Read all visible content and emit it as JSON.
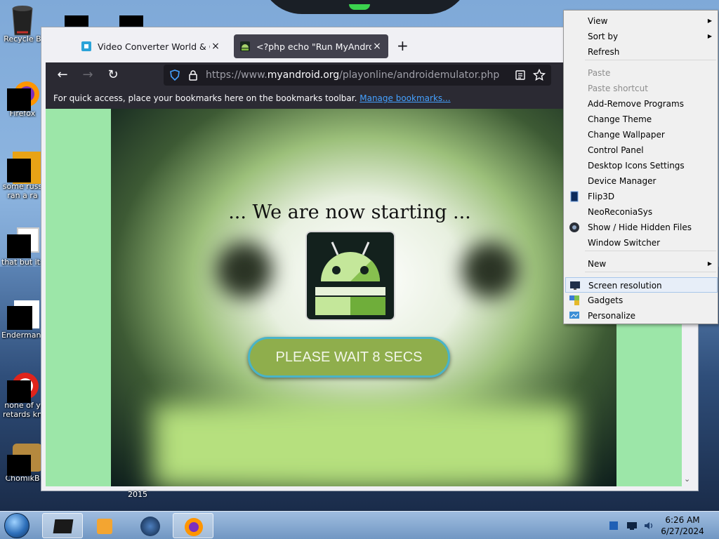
{
  "desktop": {
    "icons": [
      {
        "label": "Recycle B"
      },
      {
        "label": "Firefox"
      },
      {
        "label": "some russ",
        "label2": "ran a ra"
      },
      {
        "label": "that but its"
      },
      {
        "label": "Endermann"
      },
      {
        "label": "none of y",
        "label2": "retards kn"
      },
      {
        "label": "ChomikB"
      }
    ],
    "year_text": "2015"
  },
  "browser": {
    "tabs": [
      {
        "title": "Video Converter World & Custo",
        "close": "×"
      },
      {
        "title": "<?php echo \"Run MyAndroid\"; ?>",
        "close": "×"
      }
    ],
    "new_tab": "+",
    "url": {
      "prefix": "https://www.",
      "domain": "myandroid.org",
      "path": "/playonline/androidemulator.php"
    },
    "bookmarks_bar": {
      "text": "For quick access, place your bookmarks here on the bookmarks toolbar.",
      "link": "Manage bookmarks..."
    }
  },
  "page": {
    "headline": "... We are now starting ...",
    "button": "PLEASE WAIT 8 SECS"
  },
  "context_menu": {
    "items": [
      {
        "label": "View",
        "submenu": true
      },
      {
        "label": "Sort by",
        "submenu": true
      },
      {
        "label": "Refresh"
      },
      {
        "label": "Paste",
        "disabled": true
      },
      {
        "label": "Paste shortcut",
        "disabled": true
      },
      {
        "label": "Add-Remove Programs"
      },
      {
        "label": "Change Theme"
      },
      {
        "label": "Change Wallpaper"
      },
      {
        "label": "Control Panel"
      },
      {
        "label": "Desktop Icons Settings"
      },
      {
        "label": "Device Manager"
      },
      {
        "label": "Flip3D"
      },
      {
        "label": "NeoReconiaSys"
      },
      {
        "label": "Show / Hide Hidden Files"
      },
      {
        "label": "Window Switcher"
      },
      {
        "label": "New",
        "submenu": true
      },
      {
        "label": "Screen resolution",
        "highlighted": true
      },
      {
        "label": "Gadgets"
      },
      {
        "label": "Personalize"
      }
    ]
  },
  "taskbar": {
    "time": "6:26 AM",
    "date": "6/27/2024"
  },
  "colors": {
    "page_bg": "#9ce6a8",
    "button_fill": "#8fae4c",
    "button_border": "#49b4c8",
    "link": "#45a1ff"
  }
}
